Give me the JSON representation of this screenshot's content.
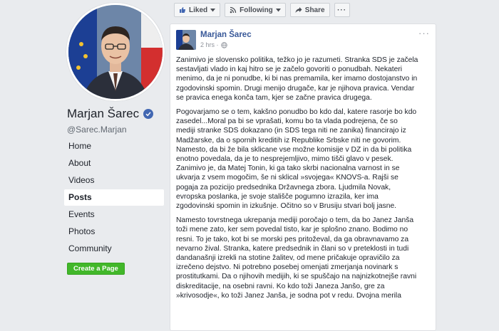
{
  "profile": {
    "name": "Marjan Šarec",
    "handle": "@Sarec.Marjan"
  },
  "nav": {
    "items": [
      {
        "label": "Home",
        "active": false
      },
      {
        "label": "About",
        "active": false
      },
      {
        "label": "Videos",
        "active": false
      },
      {
        "label": "Posts",
        "active": true
      },
      {
        "label": "Events",
        "active": false
      },
      {
        "label": "Photos",
        "active": false
      },
      {
        "label": "Community",
        "active": false
      }
    ],
    "create_page_label": "Create a Page"
  },
  "actions": {
    "liked_label": "Liked",
    "following_label": "Following",
    "share_label": "Share",
    "more_label": "···"
  },
  "post": {
    "author": "Marjan Šarec",
    "time": "2 hrs ·",
    "options_label": "···",
    "paragraphs": [
      [
        "Zanimivo je slovensko politika, težko jo je razumeti. Stranka SDS je začela",
        "sestavljati vlado in kaj hitro se je začelo govoriti o ponudbah. Nekateri",
        "menimo, da je ni ponudbe, ki bi nas premamila, ker imamo dostojanstvo in",
        "zgodovinski spomin. Drugi menijo drugače, kar je njihova pravica. Vendar",
        "se pravica enega konča tam, kjer se začne pravica drugega."
      ],
      [
        "Pogovarjamo se o tem, kakšno ponudbo bo kdo dal, katere rasorje bo kdo",
        "zasedel...Moral pa bi se vprašati, komu bo ta vlada podrejena, če so",
        "mediji stranke SDS dokazano (in SDS tega niti ne zanika) financirajo iz",
        "Madžarske, da o spornih kreditih iz Republike Srbske niti ne govorim.",
        "Namesto, da bi že bila sklicane vse možne komisije v DZ in da bi politika",
        "enotno povedala, da je to nesprejemljivo, mimo tišči glavo v pesek.",
        "Zanimivo je, da Matej Tonin, ki ga tako skrbi nacionalna varnost in se",
        "ukvarja z vsem mogočim, še ni sklical »svojega« KNOVS-a. Rajši se",
        "pogaja za pozicijo predsednika Državnega zbora. Ljudmila Novak,",
        "evropska poslanka, je svoje stališče pogumno izrazila, ker ima",
        "zgodovinski spomin in izkušnje. Očitno so v Brusiju stvari bolj jasne."
      ],
      [
        "Namesto tovrstnega ukrepanja mediji poročajo o tem, da bo Janez Janša",
        "toži mene zato, ker sem povedal tisto, kar je splošno znano. Bodimo no",
        "resni. To je tako, kot bi se morski pes pritoževal, da ga obravnavamo za",
        "nevarno žival. Stranka, katere predsednik in člani so v preteklosti in tudi",
        "dandanašnji izrekli na stotine žalitev, od mene pričakuje opravičilo za",
        "izrečeno dejstvo. Ni potrebno posebej omenjati zmerjanja novinark s",
        "prostitutkami. Da o njihovih medijih, ki se spuščajo na najnizkotnejše ravni",
        "diskreditacije, na osebni ravni. Ko kdo toži Janeza Janšo, gre za",
        "»krivosodje«, ko toži Janez Janša, je sodna pot v redu. Dvojna merila"
      ]
    ]
  },
  "colors": {
    "background": "#e9ebee",
    "link": "#385898",
    "accent_blue": "#4267b2",
    "create_green": "#42b72a"
  },
  "icons": [
    "verified-badge-icon",
    "thumbs-up-icon",
    "rss-icon",
    "share-arrow-icon",
    "globe-icon",
    "chevron-down-icon"
  ]
}
